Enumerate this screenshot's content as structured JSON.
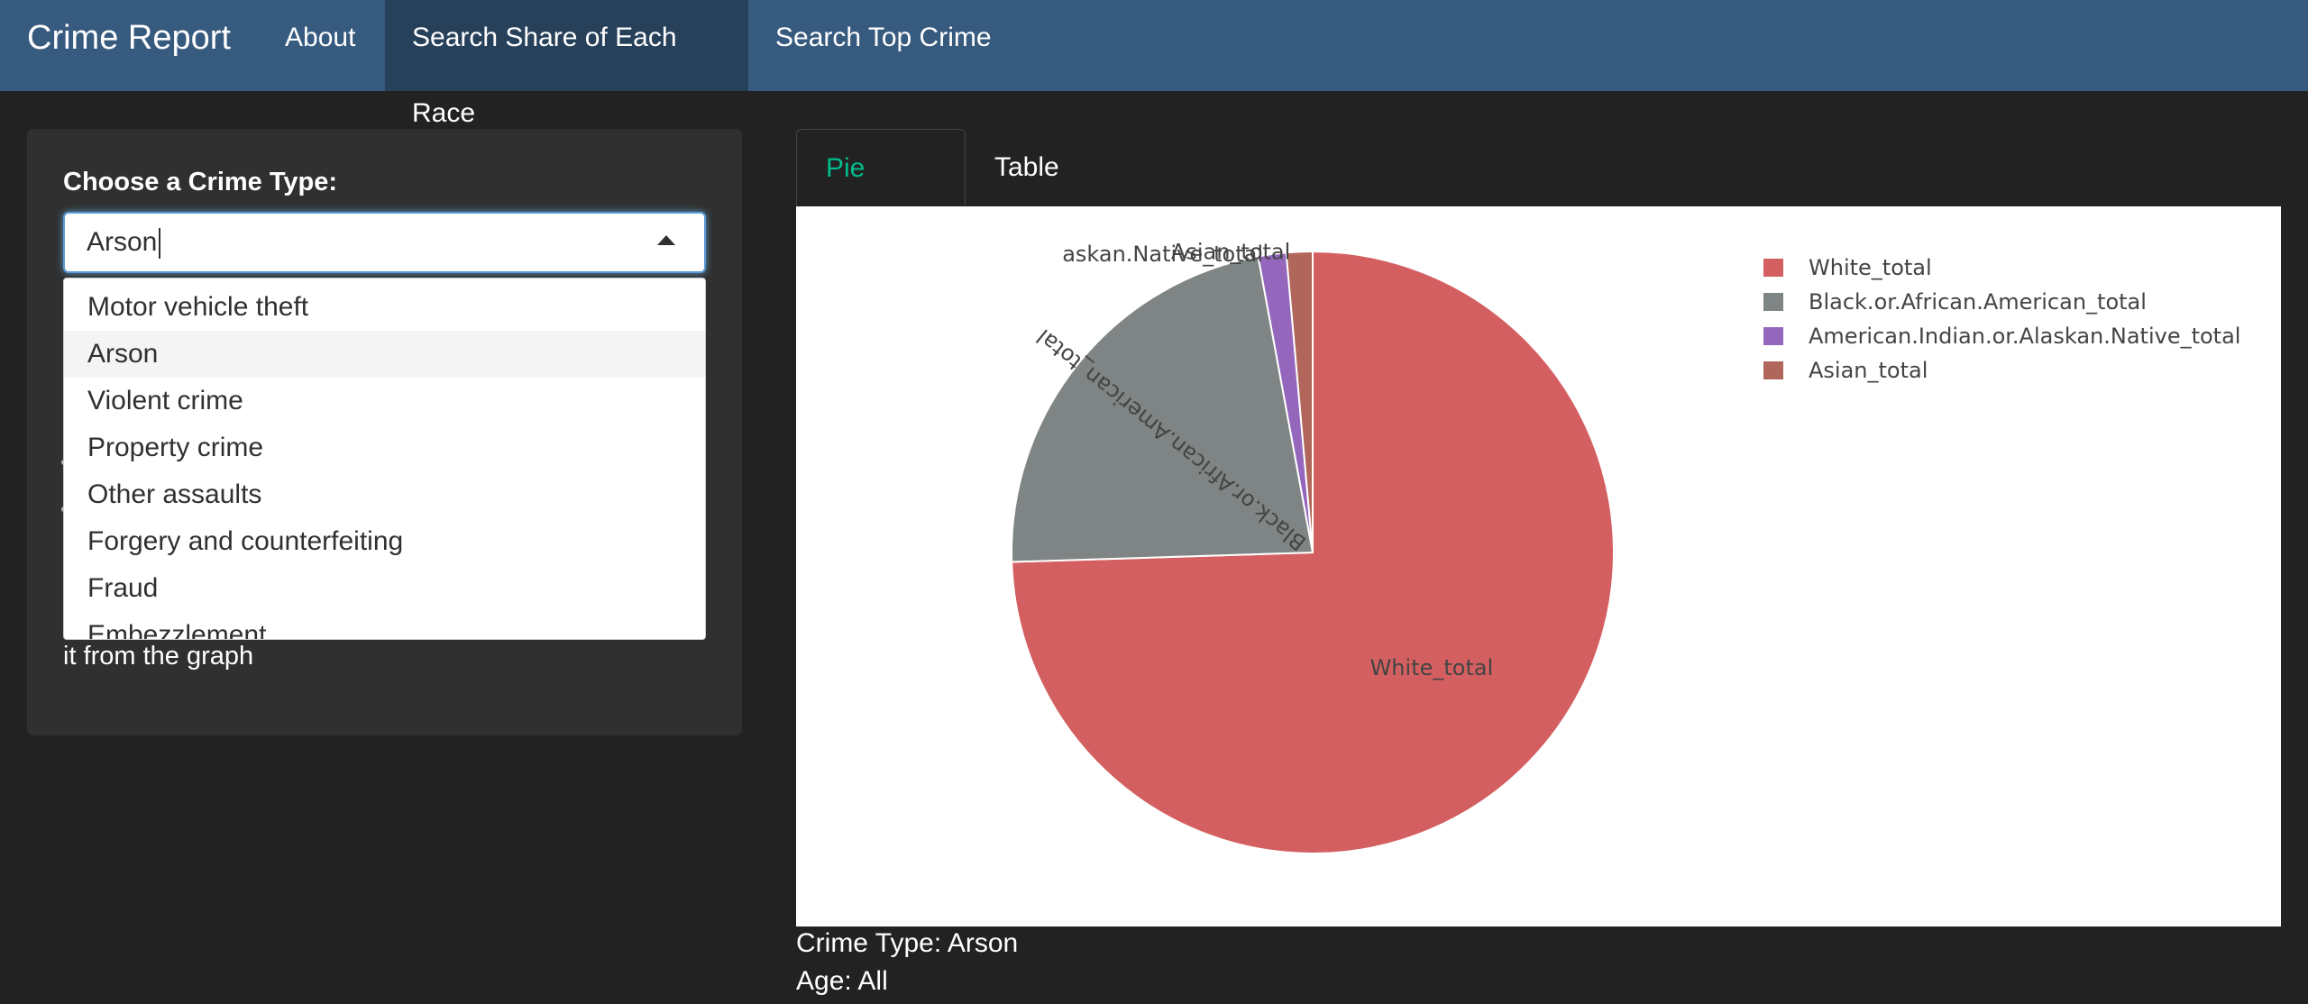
{
  "navbar": {
    "brand": "Crime Report",
    "items": [
      {
        "label": "About",
        "active": false
      },
      {
        "label": "Search Share of Each Race",
        "active": true
      },
      {
        "label": "Search Top Crime",
        "active": false
      }
    ]
  },
  "sidebar": {
    "select_label": "Choose a Crime Type:",
    "selected_value": "Arson",
    "options": [
      "Motor vehicle theft",
      "Arson",
      "Violent crime",
      "Property crime",
      "Other assaults",
      "Forgery and counterfeiting",
      "Fraud",
      "Embezzlement"
    ],
    "help_text_tail": "it from the graph"
  },
  "tabs": [
    {
      "label": "Pie Chart",
      "active": true
    },
    {
      "label": "Table",
      "active": false
    }
  ],
  "colors": {
    "navbar": "#375a7f",
    "navbar_active": "#28415b",
    "accent": "#00bc8c",
    "background": "#222222",
    "well": "#303030"
  },
  "chart_data": {
    "type": "pie",
    "labels": [
      "White_total",
      "Black.or.African.American_total",
      "American.Indian.or.Alaskan.Native_total",
      "Asian_total"
    ],
    "values": [
      74.5,
      22.6,
      1.5,
      1.4
    ],
    "colors": [
      "#d45f61",
      "#7f8585",
      "#9467bd",
      "#b0665a"
    ],
    "slice_labels": [
      "White_total",
      "Black.or.African.American_total",
      "askan.Native_total",
      "Asian_total"
    ],
    "legend": [
      "White_total",
      "Black.or.African.American_total",
      "American.Indian.or.Alaskan.Native_total",
      "Asian_total"
    ],
    "legend_position": "top-right"
  },
  "info": {
    "crime_type": "Crime Type: Arson",
    "age": "Age: All"
  }
}
